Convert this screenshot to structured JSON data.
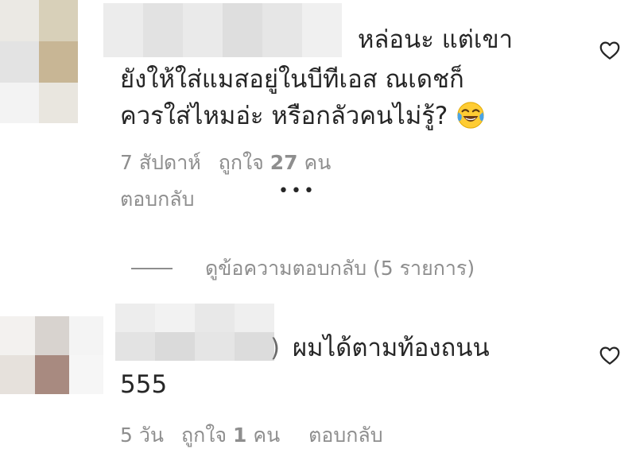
{
  "comments": [
    {
      "text_lines": [
        "หล่อนะ แต่เขา",
        "ยังให้ใส่แมสอยู่ในบีทีเอส ณเดชก็",
        "ควรใส่ไหมอ่ะ หรือกลัวคนไม่รู้?"
      ],
      "emoji": "face-with-tears-of-joy",
      "time": "7 สัปดาห์",
      "likes_prefix": "ถูกใจ",
      "likes_count": "27",
      "likes_suffix": "คน",
      "reply_label": "ตอบกลับ",
      "more_label": "•••",
      "view_replies_label": "ดูข้อความตอบกลับ (5 รายการ)"
    },
    {
      "text_line1": "ผมได้ตามท้องถนน",
      "text_line2": "555",
      "time": "5 วัน",
      "likes_prefix": "ถูกใจ",
      "likes_count": "1",
      "likes_suffix": "คน",
      "reply_label": "ตอบกลับ"
    }
  ],
  "colors": {
    "text": "#262626",
    "secondary": "#8e8e8e",
    "background": "#ffffff"
  },
  "icons": [
    "heart-outline-icon",
    "face-with-tears-of-joy-emoji",
    "more-options-icon"
  ]
}
